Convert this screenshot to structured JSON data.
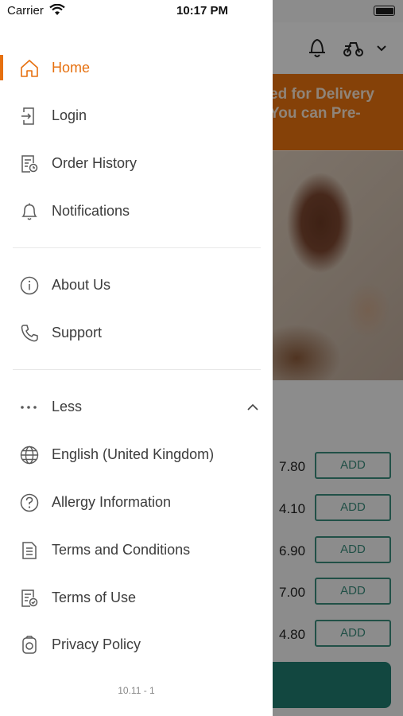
{
  "status_bar": {
    "carrier": "Carrier",
    "time": "10:17 PM"
  },
  "background": {
    "banner_line1": "ed for Delivery",
    "banner_line2": "You can Pre-",
    "prices": [
      "7.80",
      "4.10",
      "6.90",
      "7.00",
      "4.80"
    ],
    "add_label": "ADD"
  },
  "menu": {
    "home": "Home",
    "login": "Login",
    "order_history": "Order History",
    "notifications": "Notifications",
    "about_us": "About Us",
    "support": "Support",
    "less": "Less",
    "language": "English (United Kingdom)",
    "allergy": "Allergy Information",
    "terms_conditions": "Terms and Conditions",
    "terms_use": "Terms of Use",
    "privacy": "Privacy Policy"
  },
  "version": "10.11 - 1",
  "colors": {
    "accent": "#e6700f",
    "text": "#3c3c3c",
    "icon": "#5a5a5a",
    "teal": "#1f7a6e"
  },
  "icons": [
    "home-icon",
    "login-icon",
    "order-history-icon",
    "bell-icon",
    "info-icon",
    "phone-icon",
    "more-dots-icon",
    "chevron-up-icon",
    "globe-icon",
    "question-icon",
    "document-icon",
    "terms-of-use-icon",
    "privacy-icon"
  ]
}
